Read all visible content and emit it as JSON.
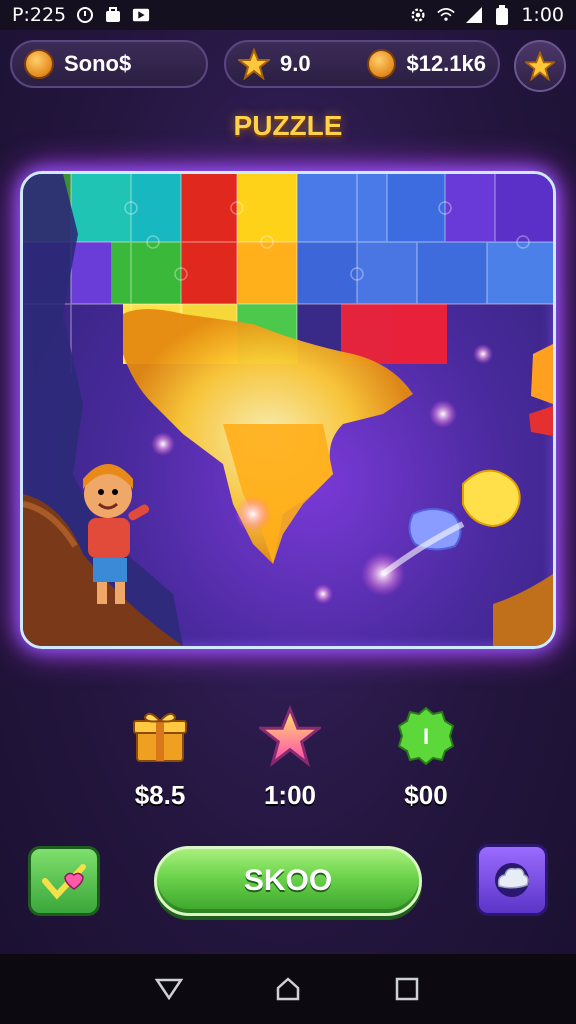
{
  "status_bar": {
    "time_left": "P:225",
    "time_right": "1:00",
    "icons_left": [
      "alarm-icon",
      "bag-icon",
      "media-icon"
    ],
    "icons_right": [
      "settings-icon",
      "wifi-icon",
      "signal-icon",
      "battery-icon"
    ]
  },
  "header": {
    "profile_name": "Sono$",
    "stars": "9.0",
    "balance": "$12.1k6"
  },
  "title": "PUZZLE",
  "rewards": [
    {
      "icon": "gift-icon",
      "value": "$8.5"
    },
    {
      "icon": "star-icon",
      "value": "1:00"
    },
    {
      "icon": "green-badge-icon",
      "value": "$00",
      "badge_text": "I"
    }
  ],
  "actions": {
    "play_label": "SKOO",
    "left_icon": "check-heart-icon",
    "right_icon": "cloud-icon"
  },
  "nav": [
    "back-icon",
    "home-icon",
    "recents-icon"
  ],
  "colors": {
    "accent_gold": "#ffd24a",
    "play_green": "#6ad24a",
    "board_glow": "#c23cff",
    "background": "#24163f"
  }
}
